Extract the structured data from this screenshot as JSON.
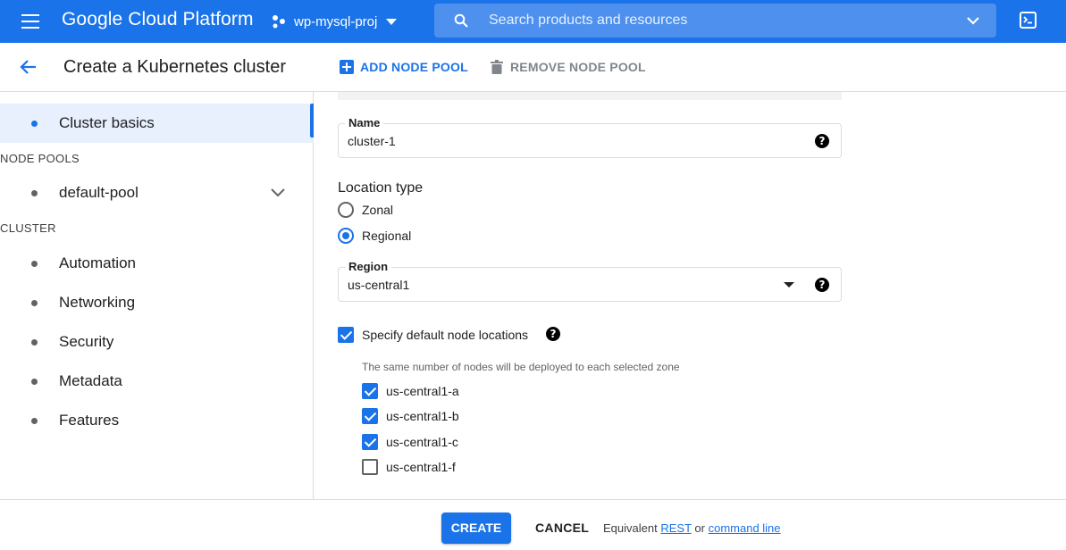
{
  "topbar": {
    "brand": "Google Cloud Platform",
    "project": "wp-mysql-proj",
    "search_placeholder": "Search products and resources"
  },
  "header": {
    "title": "Create a Kubernetes cluster",
    "add_node_pool": "ADD NODE POOL",
    "remove_node_pool": "REMOVE NODE POOL"
  },
  "sidebar": {
    "cluster_basics": "Cluster basics",
    "node_pools_header": "NODE POOLS",
    "default_pool": "default-pool",
    "cluster_header": "CLUSTER",
    "automation": "Automation",
    "networking": "Networking",
    "security": "Security",
    "metadata": "Metadata",
    "features": "Features"
  },
  "form": {
    "name_label": "Name",
    "name_value": "cluster-1",
    "location_type_title": "Location type",
    "zonal_label": "Zonal",
    "regional_label": "Regional",
    "location_selected": "Regional",
    "region_label": "Region",
    "region_value": "us-central1",
    "specify_locations_label": "Specify default node locations",
    "specify_locations_checked": true,
    "zones_hint": "The same number of nodes will be deployed to each selected zone",
    "zones": [
      {
        "label": "us-central1-a",
        "checked": true
      },
      {
        "label": "us-central1-b",
        "checked": true
      },
      {
        "label": "us-central1-c",
        "checked": true
      },
      {
        "label": "us-central1-f",
        "checked": false
      }
    ]
  },
  "footer": {
    "create": "CREATE",
    "cancel": "CANCEL",
    "equivalent_prefix": "Equivalent",
    "rest_link": "REST",
    "or_text": "or",
    "command_line_link": "command line"
  },
  "colors": {
    "accent": "#1a73e8",
    "topbar_bg": "#1a73e8"
  }
}
